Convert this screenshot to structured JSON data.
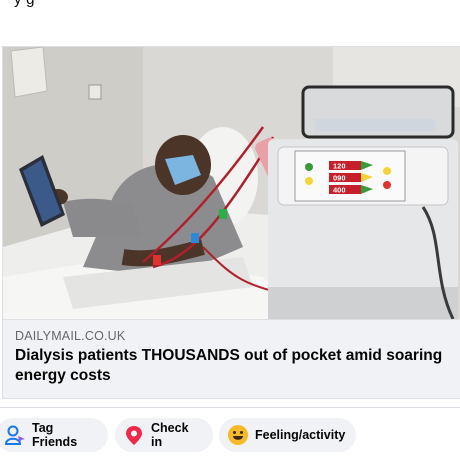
{
  "post": {
    "top_text": "y    g"
  },
  "link_card": {
    "source": "DAILYMAIL.CO.UK",
    "headline": "Dialysis patients THOUSANDS out of pocket amid soaring energy costs",
    "image_alt": "Patient receiving dialysis treatment next to a dialysis machine"
  },
  "machine_readouts": [
    "120",
    "090",
    "400"
  ],
  "composer_actions": [
    {
      "label": "Tag Friends",
      "icon": "tag-friends-icon"
    },
    {
      "label": "Check in",
      "icon": "location-pin-icon"
    },
    {
      "label": "Feeling/activity",
      "icon": "smiley-icon"
    }
  ],
  "colors": {
    "card_bg": "#f0f2f5",
    "source_text": "#65676b",
    "tag_icon": "#1877f2",
    "pin_icon": "#f02849",
    "smiley_icon": "#f7b928"
  }
}
